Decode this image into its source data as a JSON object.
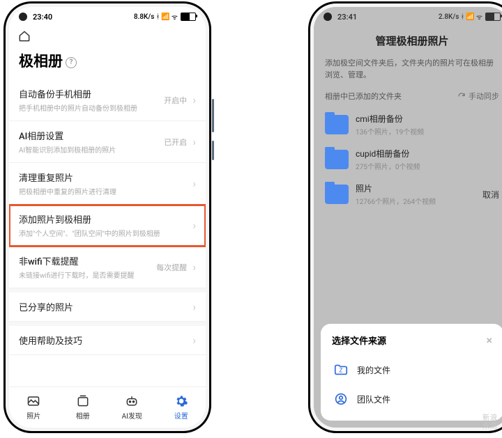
{
  "left": {
    "status": {
      "time": "23:40",
      "net": "8.8K/s",
      "icons": "⚪ᯤ ▮▮▯▯"
    },
    "title": "极相册",
    "rows": [
      {
        "t1": "自动备份手机相册",
        "t2": "把手机相册中的照片自动备份到极相册",
        "meta": "开启中",
        "hl": false
      },
      {
        "t1": "AI相册设置",
        "t2": "AI智能识别添加到极相册的照片",
        "meta": "已开启",
        "hl": false
      },
      {
        "t1": "清理重复照片",
        "t2": "把极相册中重复的照片进行清理",
        "meta": "",
        "hl": false
      },
      {
        "t1": "添加照片到极相册",
        "t2": "添加\"个人空间\"、\"团队空间\"中的照片到极相册",
        "meta": "",
        "hl": true
      },
      {
        "t1": "非wifi下载提醒",
        "t2": "未链接wifi进行下载时，是否需要提醒",
        "meta": "每次提醒",
        "hl": false
      },
      {
        "t1": "已分享的照片",
        "t2": "",
        "meta": "",
        "hl": false
      },
      {
        "t1": "使用帮助及技巧",
        "t2": "",
        "meta": "",
        "hl": false
      }
    ],
    "tabs": [
      {
        "label": "照片"
      },
      {
        "label": "相册"
      },
      {
        "label": "AI发现"
      },
      {
        "label": "设置"
      }
    ]
  },
  "right": {
    "status": {
      "time": "23:41",
      "net": "2.8K/s"
    },
    "title": "管理极相册照片",
    "desc": "添加极空间文件夹后，文件夹内的照片可在极相册浏览、管理。",
    "sub": "相册中已添加的文件夹",
    "sync": "手动同步",
    "folders": [
      {
        "name": "cmi相册备份",
        "meta": "136个照片，19个视频",
        "cancel": false
      },
      {
        "name": "cupid相册备份",
        "meta": "275个照片，0个视频",
        "cancel": false
      },
      {
        "name": "照片",
        "meta": "12766个照片，264个视频",
        "cancel": true
      }
    ],
    "cancel_label": "取消",
    "sheet": {
      "title": "选择文件来源",
      "items": [
        {
          "label": "我的文件",
          "icon": "file"
        },
        {
          "label": "团队文件",
          "icon": "team"
        }
      ]
    }
  },
  "watermark": {
    "l1": "新浪",
    "l2": "众测"
  }
}
